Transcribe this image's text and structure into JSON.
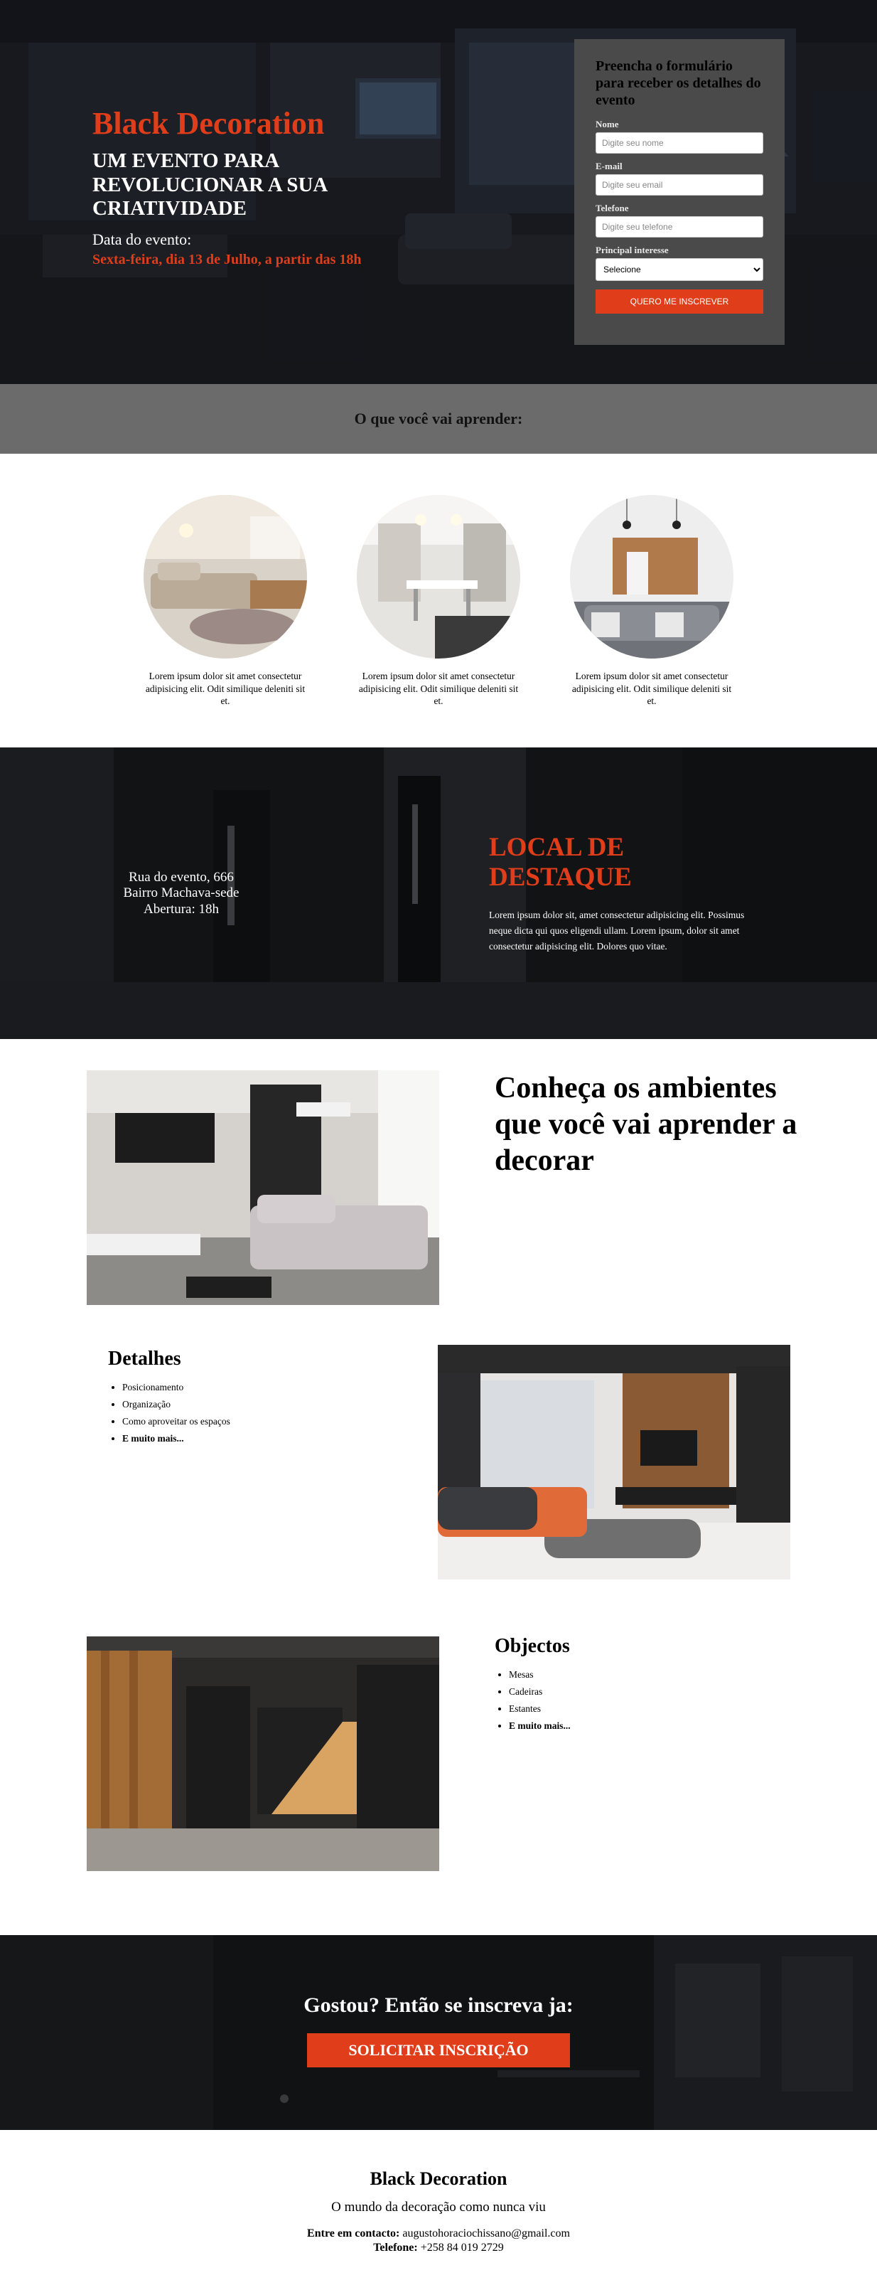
{
  "hero": {
    "title": "Black Decoration",
    "subtitle": "UM EVENTO PARA REVOLUCIONAR A SUA CRIATIVIDADE",
    "date_label": "Data do evento:",
    "date_value": "Sexta-feira, dia 13 de Julho, a partir das 18h"
  },
  "form": {
    "heading": "Preencha o formulário para receber os detalhes do evento",
    "name_label": "Nome",
    "name_placeholder": "Digite seu nome",
    "email_label": "E-mail",
    "email_placeholder": "Digite seu email",
    "phone_label": "Telefone",
    "phone_placeholder": "Digite seu telefone",
    "interest_label": "Principal interesse",
    "interest_selected": "Selecione",
    "submit_label": "QUERO ME INSCREVER"
  },
  "learn": {
    "heading": "O que você vai aprender:",
    "cards": [
      {
        "text": "Lorem ipsum dolor sit amet consectetur adipisicing elit. Odit similique deleniti sit et."
      },
      {
        "text": "Lorem ipsum dolor sit amet consectetur adipisicing elit. Odit similique deleniti sit et."
      },
      {
        "text": "Lorem ipsum dolor sit amet consectetur adipisicing elit. Odit similique deleniti sit et."
      }
    ]
  },
  "local": {
    "address_line1": "Rua do evento, 666",
    "address_line2": "Bairro Machava-sede",
    "address_line3": "Abertura: 18h",
    "title": "LOCAL DE DESTAQUE",
    "text": "Lorem ipsum dolor sit, amet consectetur adipisicing elit. Possimus neque dicta qui quos eligendi ullam. Lorem ipsum, dolor sit amet consectetur adipisicing elit. Dolores quo vitae."
  },
  "ambientes": {
    "title": "Conheça os ambientes que você vai aprender a decorar"
  },
  "detalhes": {
    "title": "Detalhes",
    "items": [
      "Posicionamento",
      "Organização",
      "Como aproveitar os espaços",
      "E muito mais..."
    ]
  },
  "objectos": {
    "title": "Objectos",
    "items": [
      "Mesas",
      "Cadeiras",
      "Estantes",
      "E muito mais..."
    ]
  },
  "cta": {
    "heading": "Gostou? Então se inscreva ja:",
    "button_label": "SOLICITAR INSCRIÇÃO"
  },
  "footer": {
    "title": "Black Decoration",
    "tagline": "O mundo da decoração como nunca viu",
    "contact_label": "Entre em contacto:",
    "contact_email": "augustohoraciochissano@gmail.com",
    "phone_label": "Telefone:",
    "phone_value": "+258 84 019 2729"
  },
  "colors": {
    "accent": "#e03d1a",
    "form_card": "#4a4a4a",
    "learn_band": "#6b6b6b"
  }
}
